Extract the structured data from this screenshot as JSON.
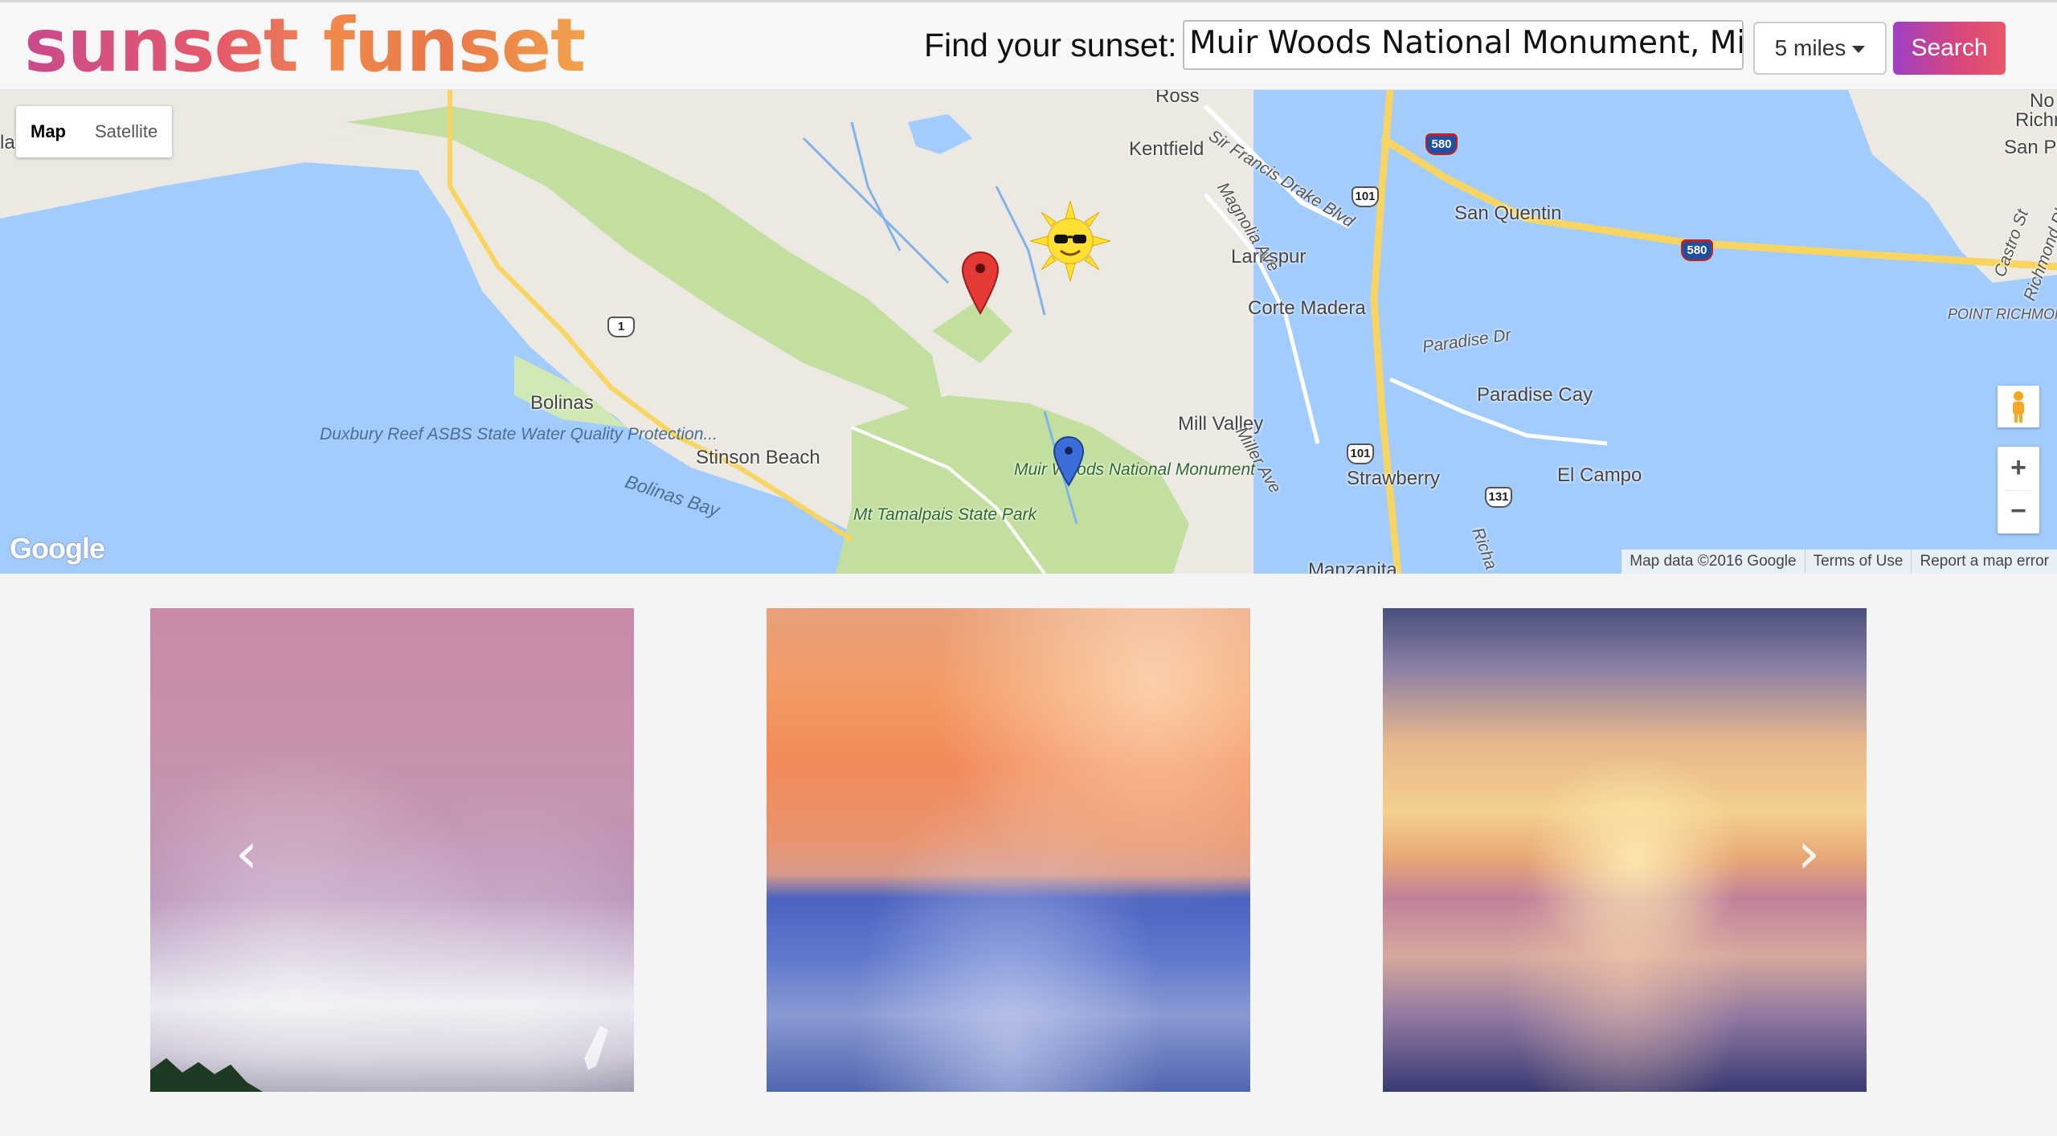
{
  "header": {
    "logo_text": "sunset funset",
    "find_label": "Find your sunset:",
    "search_value": "Muir Woods National Monument, Mill",
    "radius_value": "5 miles",
    "search_button": "Search"
  },
  "map": {
    "type_controls": [
      "Map",
      "Satellite"
    ],
    "places": [
      "Kentfield",
      "San Quentin",
      "Larkspur",
      "Corte Madera",
      "Paradise Dr",
      "Paradise Cay",
      "Bolinas",
      "Stinson Beach",
      "Mill Valley",
      "Strawberry",
      "El Campo",
      "Manzanita",
      "Richmond Pkwy",
      "San Pa",
      "Richr",
      "No",
      "Castro St",
      "POINT RICHMOND",
      "Sir Francis Drake Blvd",
      "Magnolia Ave",
      "Miller Ave",
      "Bolinas Bay",
      "Ross",
      "Richa",
      "la"
    ],
    "park_labels": {
      "duxbury": "Duxbury Reef ASBS State Water Quality Protection...",
      "tamalpais": "Mt Tamalpais State Park",
      "muir_woods": "Muir Woods National Monument"
    },
    "highway_shields": [
      "1",
      "101",
      "101",
      "101",
      "580",
      "580",
      "131"
    ],
    "markers": [
      {
        "name": "red-pin",
        "color": "#e53935"
      },
      {
        "name": "blue-pin",
        "color": "#3b6ed9"
      },
      {
        "name": "sun-with-sunglasses",
        "color": "#ffe033"
      }
    ],
    "zoom_in": "+",
    "zoom_out": "−",
    "logo": "Google",
    "attribution": [
      "Map data ©2016 Google",
      "Terms of Use",
      "Report a map error"
    ]
  },
  "photos": [
    {
      "name": "pink-fog-sunset",
      "colors": [
        "#c88aa6",
        "#b98fb0",
        "#d3bcd0"
      ]
    },
    {
      "name": "orange-sky-blue-fog",
      "colors": [
        "#f2905e",
        "#e48e73",
        "#4a5fbf"
      ]
    },
    {
      "name": "golden-cloud-sunset",
      "colors": [
        "#f3c07a",
        "#a97da8",
        "#3f3f7f"
      ]
    }
  ],
  "carousel": {
    "prev": "‹",
    "next": "›"
  }
}
